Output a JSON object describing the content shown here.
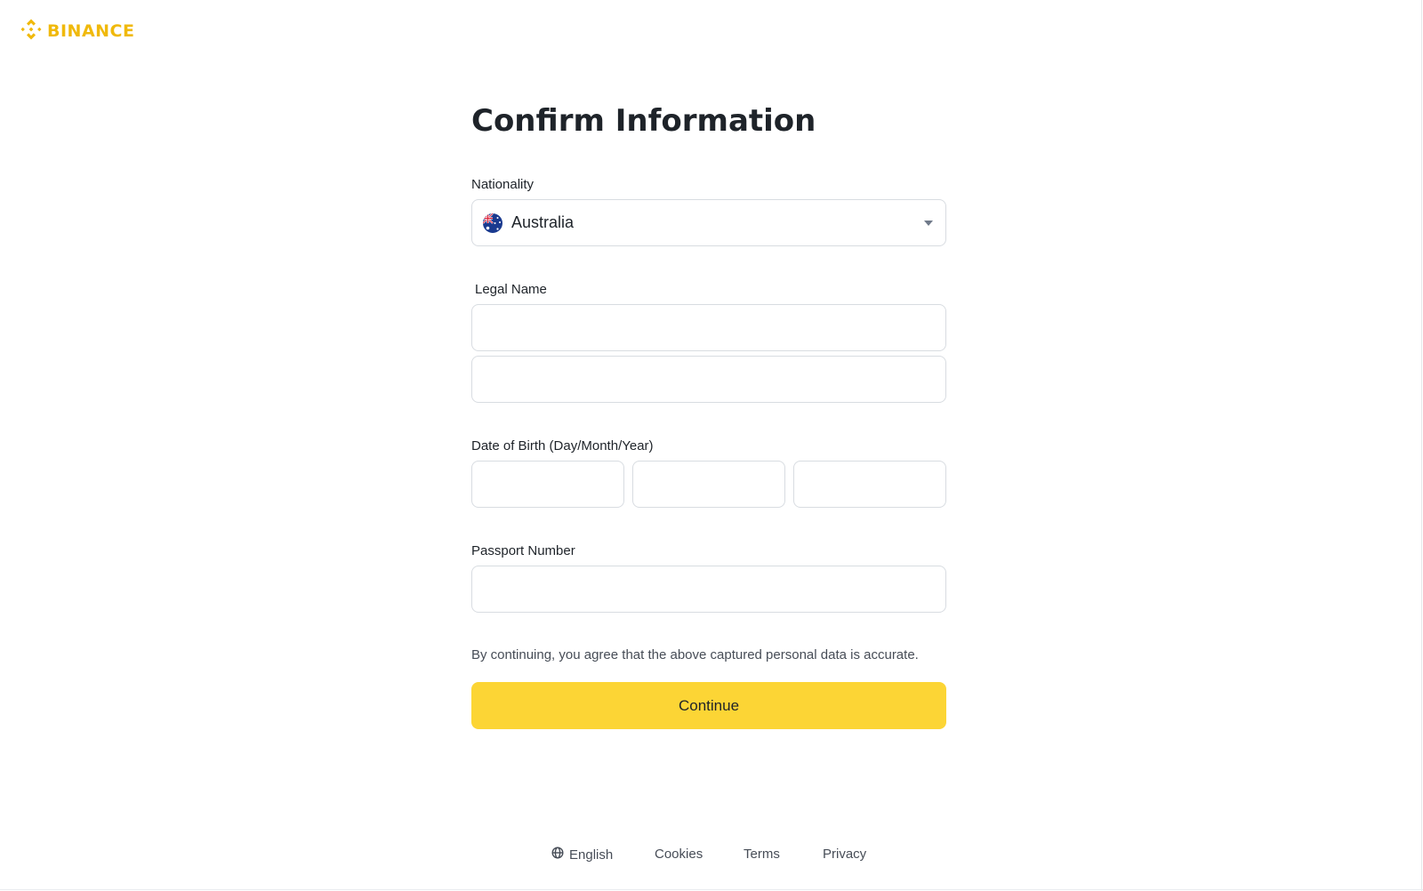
{
  "brand": {
    "name": "BINANCE",
    "color": "#F0B90B"
  },
  "form": {
    "title": "Confirm Information",
    "nationality": {
      "label": "Nationality",
      "value": "Australia",
      "flag_icon": "australia-flag-icon"
    },
    "legal_name": {
      "label": "Legal Name",
      "first_value": "",
      "second_value": ""
    },
    "date_of_birth": {
      "label": "Date of Birth (Day/Month/Year)",
      "day": "",
      "month": "",
      "year": ""
    },
    "passport_number": {
      "label": "Passport Number",
      "value": ""
    },
    "consent_note": "By continuing, you agree that the above captured personal data is accurate.",
    "continue_label": "Continue",
    "continue_color": "#FCD535"
  },
  "footer": {
    "language": "English",
    "language_icon": "globe-icon",
    "cookies": "Cookies",
    "terms": "Terms",
    "privacy": "Privacy"
  }
}
